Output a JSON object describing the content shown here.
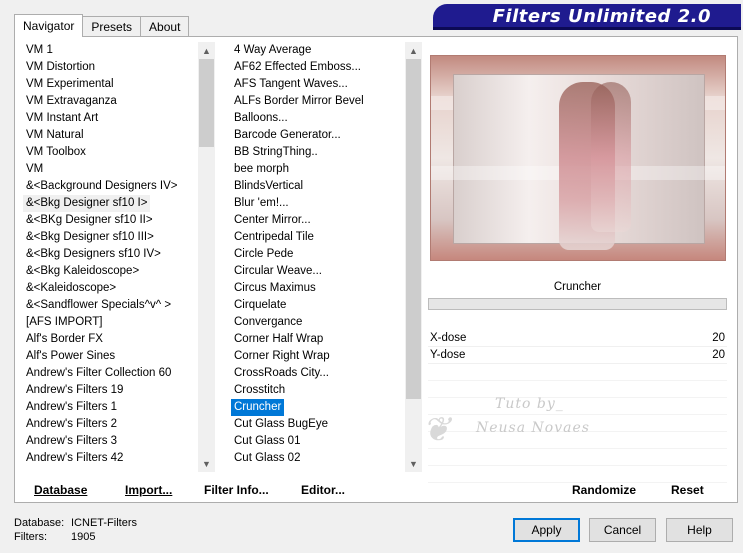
{
  "tabs": [
    {
      "label": "Navigator",
      "active": true
    },
    {
      "label": "Presets",
      "active": false
    },
    {
      "label": "About",
      "active": false
    }
  ],
  "banner": {
    "title": "Filters Unlimited 2.0",
    "color": "#1f1b8f"
  },
  "filter_list_left": [
    "VM 1",
    "VM Distortion",
    "VM Experimental",
    "VM Extravaganza",
    "VM Instant Art",
    "VM Natural",
    "VM Toolbox",
    "VM",
    "&<Background Designers IV>",
    "&<Bkg Designer sf10 I>",
    "&<BKg Designer sf10 II>",
    "&<Bkg Designer sf10 III>",
    "&<Bkg Designers sf10 IV>",
    "&<Bkg Kaleidoscope>",
    "&<Kaleidoscope>",
    "&<Sandflower Specials^v^ >",
    "[AFS IMPORT]",
    "Alf's Border FX",
    "Alf's Power Sines",
    "Andrew's Filter Collection 60",
    "Andrew's Filters 19",
    "Andrew's Filters 1",
    "Andrew's Filters 2",
    "Andrew's Filters 3",
    "Andrew's Filters 42"
  ],
  "filter_list_left_hover_index": 9,
  "filter_list_right": [
    "4 Way Average",
    "AF62 Effected Emboss...",
    "AFS Tangent Waves...",
    "ALFs Border Mirror Bevel",
    "Balloons...",
    "Barcode Generator...",
    "BB StringThing..",
    "bee morph",
    "BlindsVertical",
    "Blur 'em!...",
    "Center Mirror...",
    "Centripedal Tile",
    "Circle Pede",
    "Circular Weave...",
    "Circus Maximus",
    "Cirquelate",
    "Convergance",
    "Corner Half Wrap",
    "Corner Right Wrap",
    "CrossRoads City...",
    "Crosstitch",
    "Cruncher",
    "Cut Glass  BugEye",
    "Cut Glass 01",
    "Cut Glass 02"
  ],
  "filter_list_right_selected_index": 21,
  "selected_filter": "Cruncher",
  "controls": [
    {
      "label": "X-dose",
      "value": "20"
    },
    {
      "label": "Y-dose",
      "value": "20"
    }
  ],
  "watermark": {
    "line1": "Tuto by_",
    "line2": "Neusa Novaes"
  },
  "toolbar": {
    "database": "Database",
    "import": "Import...",
    "filter_info": "Filter Info...",
    "editor": "Editor...",
    "randomize": "Randomize",
    "reset": "Reset"
  },
  "status": {
    "database_label": "Database:",
    "database_value": "ICNET-Filters",
    "filters_label": "Filters:",
    "filters_value": "1905"
  },
  "buttons": {
    "apply": "Apply",
    "cancel": "Cancel",
    "help": "Help"
  },
  "accent_color": "#0078d7"
}
